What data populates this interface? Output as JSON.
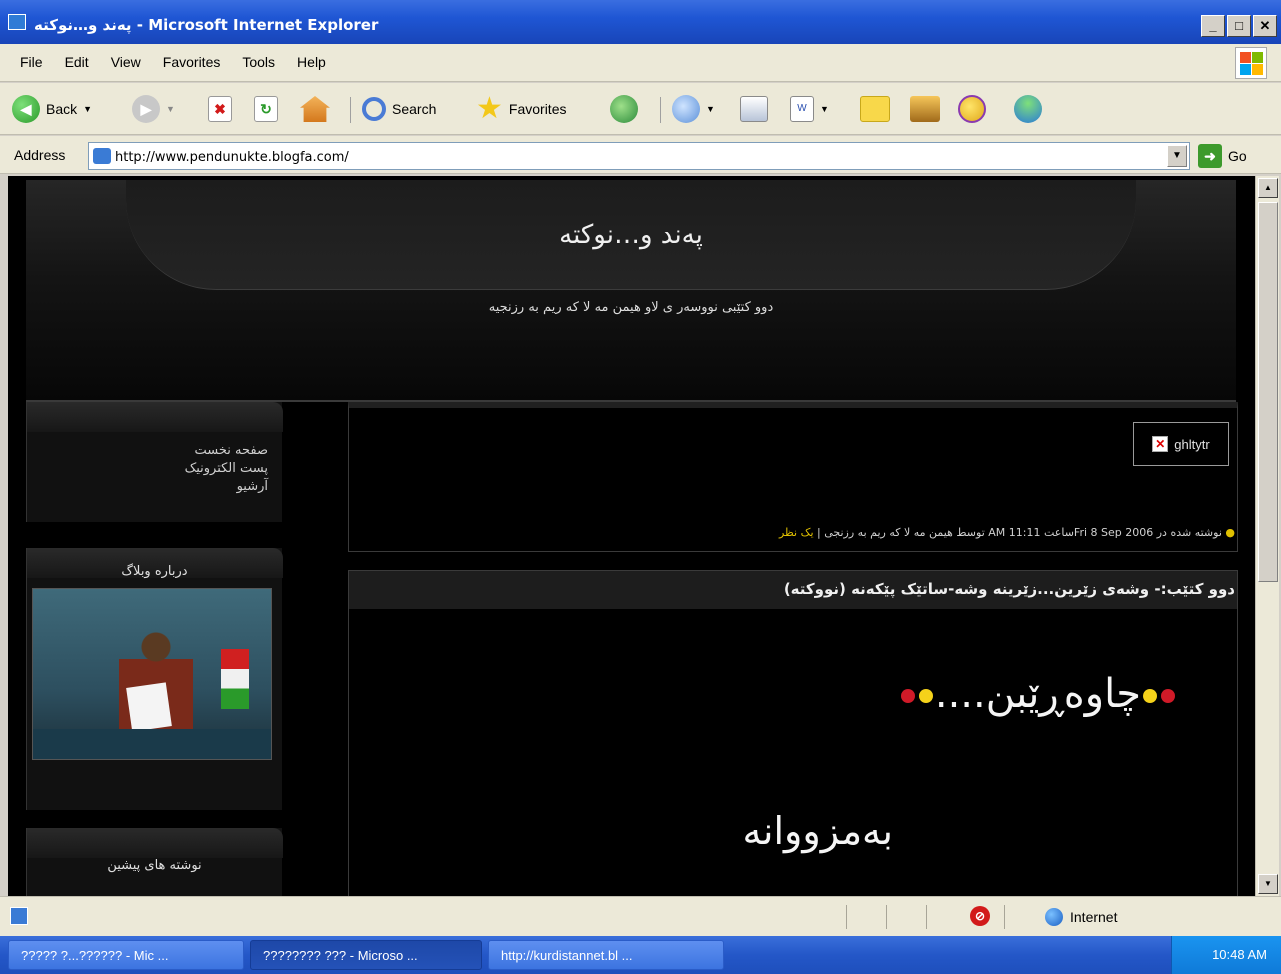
{
  "window": {
    "title": "پەند و…نوکتە - Microsoft Internet Explorer",
    "controls": [
      "_",
      "□",
      "✕"
    ]
  },
  "menu": [
    "File",
    "Edit",
    "View",
    "Favorites",
    "Tools",
    "Help"
  ],
  "toolbar": {
    "back_label": "Back",
    "search_label": "Search",
    "favorites_label": "Favorites"
  },
  "address": {
    "label": "Address",
    "url": "http://www.pendunukte.blogfa.com/",
    "go_label": "Go"
  },
  "blog": {
    "title": "پەند و…نوکتە",
    "subtitle": "دوو کتێبی نووسەر ی لاو هیمن مه لا که ریم به رزنجیه"
  },
  "sidebar": {
    "links": [
      "صفحه نخست",
      "پست الکترونیک",
      "آرشیو"
    ],
    "about_heading": "درباره وبلاگ",
    "previous_posts_heading": "نوشته های پیشین"
  },
  "post1": {
    "broken_image_alt": "ghltytr",
    "meta": "نوشته شده در  Fri 8 Sep 2006ساعت 11:11 AM  توسط هیمن مه لا که ریم به رزنجی",
    "comment_link": "یک نظر"
  },
  "post2": {
    "title": "دوو کتێب:- وشەی زێرین...زێرینە وشە-ساتێک پێکەنە (نووکتە)",
    "line1": "چاوەڕێبن....",
    "line2": "بەمزووانە"
  },
  "status": {
    "zone": "Internet"
  },
  "taskbar": {
    "buttons": [
      {
        "label": "????? ?...?????? - Mic ...",
        "active": false
      },
      {
        "label": "???????? ??? - Microso ...",
        "active": true
      },
      {
        "label": "http://kurdistannet.bl ...",
        "active": false
      }
    ],
    "clock": "10:48 AM"
  },
  "colors": {
    "titlebar": "#1f56d4",
    "page_bg": "#000000",
    "comment_link": "#e0c000",
    "chrome": "#ece9d8"
  }
}
